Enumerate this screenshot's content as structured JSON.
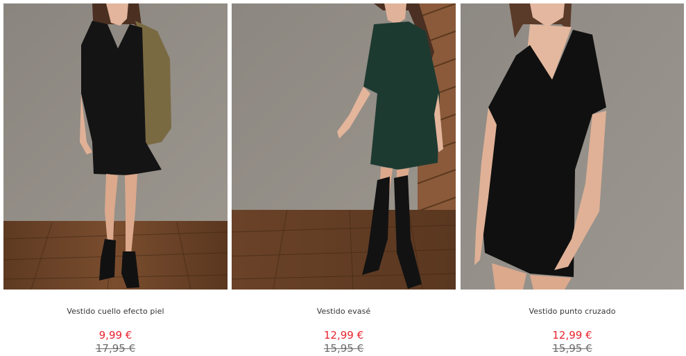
{
  "products": [
    {
      "name": "Vestido cuello efecto piel",
      "sale_price": "9,99 €",
      "original_price": "17,95 €",
      "image": "woman-black-v-neck-dress-khaki-jacket-photo"
    },
    {
      "name": "Vestido evasé",
      "sale_price": "12,99 €",
      "original_price": "15,95 €",
      "image": "woman-green-swing-dress-thigh-boots-photo"
    },
    {
      "name": "Vestido punto cruzado",
      "sale_price": "12,99 €",
      "original_price": "15,95 €",
      "image": "woman-black-wrap-bodycon-dress-photo"
    }
  ],
  "colors": {
    "sale_price": "#e8222d",
    "original_price": "#6b6b6b",
    "product_name": "#333333",
    "wall": "#8e8a84",
    "floor": "#6b4328"
  }
}
